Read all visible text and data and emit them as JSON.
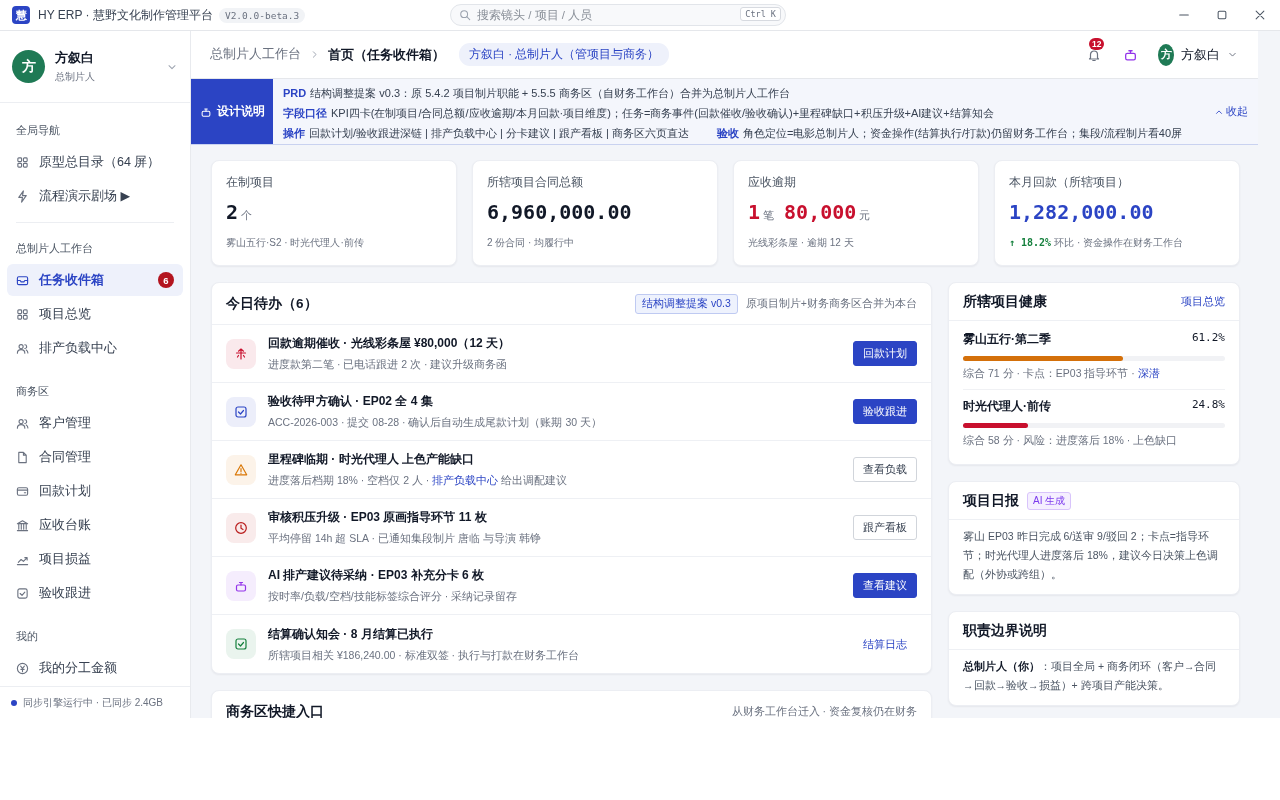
{
  "titlebar": {
    "logo": "慧",
    "title": "HY ERP · 慧野文化制作管理平台",
    "version": "V2.0.0-beta.3",
    "search": {
      "placeholder": "搜索镜头 / 项目 / 人员"
    },
    "shortcut": "Ctrl K"
  },
  "sidebar": {
    "user": {
      "avatar": "方",
      "name": "方叙白",
      "role": "总制片人"
    },
    "sections": [
      {
        "title": "全局导航",
        "items": [
          {
            "label": "原型总目录（64 屏）",
            "selected": false
          },
          {
            "label": "流程演示剧场 ▶",
            "selected": false
          }
        ]
      },
      {
        "title": "总制片人工作台",
        "items": [
          {
            "label": "任务收件箱",
            "selected": true,
            "badge": "6"
          },
          {
            "label": "项目总览",
            "selected": false
          },
          {
            "label": "排产负载中心",
            "selected": false
          }
        ]
      },
      {
        "title": "商务区",
        "items": [
          {
            "label": "客户管理",
            "selected": false
          },
          {
            "label": "合同管理",
            "selected": false
          },
          {
            "label": "回款计划",
            "selected": false
          },
          {
            "label": "应收台账",
            "selected": false
          },
          {
            "label": "项目损益",
            "selected": false
          },
          {
            "label": "验收跟进",
            "selected": false
          }
        ]
      },
      {
        "title": "我的",
        "items": [
          {
            "label": "我的分工金额",
            "selected": false
          }
        ]
      }
    ],
    "status": "同步引擎运行中 · 已同步 2.4GB"
  },
  "header": {
    "breadcrumb": [
      "总制片人工作台",
      "首页（任务收件箱）"
    ],
    "role": "方叙白 · 总制片人（管项目与商务）",
    "notifications": "12",
    "user": {
      "avatar": "方",
      "name": "方叙白"
    }
  },
  "banner": {
    "label": "设计说明",
    "collapse": "收起",
    "lines": [
      [
        {
          "key": "PRD",
          "text": "结构调整提案 v0.3：原 5.4.2 项目制片职能 + 5.5.5 商务区（自财务工作台）合并为总制片人工作台"
        }
      ],
      [
        {
          "key": "字段口径",
          "text": "KPI四卡(在制项目/合同总额/应收逾期/本月回款·项目维度)；任务=商务事件(回款催收/验收确认)+里程碑缺口+积压升级+AI建议+结算知会"
        }
      ],
      [
        {
          "key": "操作",
          "text": "回款计划/验收跟进深链 | 排产负载中心 | 分卡建议 | 跟产看板 | 商务区六页直达"
        },
        {
          "key": "验收",
          "text": "角色定位=电影总制片人；资金操作(结算执行/打款)仍留财务工作台；集段/流程制片看40屏"
        }
      ]
    ]
  },
  "kpis": [
    {
      "label": "在制项目",
      "color": "#111827",
      "values": [
        {
          "value": "2",
          "unit": "个"
        }
      ],
      "sub": "雾山五行·S2 · 时光代理人·前传"
    },
    {
      "label": "所辖项目合同总额",
      "color": "#111827",
      "values": [
        {
          "value": "6,960,000.00"
        }
      ],
      "sub": "2 份合同 · 均履行中"
    },
    {
      "label": "应收逾期",
      "color": "#c8102e",
      "values": [
        {
          "value": "1",
          "unit": "笔"
        },
        {
          "value": "80,000",
          "unit": "元"
        }
      ],
      "sub": "光线彩条屋 · 逾期 12 天"
    },
    {
      "label": "本月回款（所辖项目）",
      "color": "#2b44c4",
      "values": [
        {
          "value": "1,282,000.00"
        }
      ],
      "trend": "↑ 18.2%",
      "sub": "环比 · 资金操作在财务工作台"
    }
  ],
  "todo": {
    "title": "今日待办（6）",
    "tag": "结构调整提案 v0.3",
    "note": "原项目制片+财务商务区合并为本台",
    "items": [
      {
        "title": "回款逾期催收 · 光线彩条屋 ¥80,000（12 天）",
        "desc": [
          {
            "text": "进度款第二笔 · 已电话跟进 2 次 · 建议升级商务函"
          }
        ],
        "action": {
          "label": "回款计划",
          "kind": "primary"
        }
      },
      {
        "title": "验收待甲方确认 · EP02 全 4 集",
        "desc": [
          {
            "text": "ACC-2026-003 · 提交 08-28 · 确认后自动生成尾款计划（账期 30 天）"
          }
        ],
        "action": {
          "label": "验收跟进",
          "kind": "primary"
        }
      },
      {
        "title": "里程碑临期 · 时光代理人 上色产能缺口",
        "desc": [
          {
            "text": "进度落后档期 18% · 空档仅 2 人 · "
          },
          {
            "text": "排产负载中心",
            "link": true
          },
          {
            "text": " 给出调配建议"
          }
        ],
        "action": {
          "label": "查看负载",
          "kind": "outline"
        }
      },
      {
        "title": "审核积压升级 · EP03 原画指导环节 11 枚",
        "desc": [
          {
            "text": "平均停留 14h 超 SLA · 已通知集段制片 唐临 与导演 韩铮"
          }
        ],
        "action": {
          "label": "跟产看板",
          "kind": "outline"
        }
      },
      {
        "title": "AI 排产建议待采纳 · EP03 补充分卡 6 枚",
        "desc": [
          {
            "text": "按时率/负载/空档/技能标签综合评分 · 采纳记录留存"
          }
        ],
        "action": {
          "label": "查看建议",
          "kind": "primary"
        }
      },
      {
        "title": "结算确认知会 · 8 月结算已执行",
        "desc": [
          {
            "text": "所辖项目相关 ¥186,240.00 · 标准双签 · 执行与打款在财务工作台"
          }
        ],
        "action": {
          "label": "结算日志",
          "kind": "link"
        }
      }
    ]
  },
  "quick": {
    "title": "商务区快捷入口",
    "note": "从财务工作台迁入 · 资金复核仍在财务"
  },
  "health": {
    "title": "所辖项目健康",
    "link": "项目总览",
    "projects": [
      {
        "name": "雾山五行·第二季",
        "percent": "61.2%",
        "level": 0.612,
        "color": "#d4700a",
        "note": [
          {
            "text": "综合 71 分 · 卡点：EP03 指导环节 · "
          },
          {
            "text": "深潜",
            "link": true
          }
        ]
      },
      {
        "name": "时光代理人·前传",
        "percent": "24.8%",
        "level": 0.248,
        "color": "#c8102e",
        "note": [
          {
            "text": "综合 58 分 · 风险：进度落后 18% · 上色缺口"
          }
        ]
      }
    ]
  },
  "report": {
    "title": "项目日报",
    "tag": "AI 生成",
    "text": "雾山 EP03 昨日完成 6/送审 9/驳回 2；卡点=指导环节；时光代理人进度落后 18%，建议今日决策上色调配（外协或跨组）。"
  },
  "duty": {
    "title": "职责边界说明",
    "text": "**总制片人（你）**：项目全局 + 商务闭环（客户→合同→回款→验收→损益）+ 跨项目产能决策。"
  }
}
